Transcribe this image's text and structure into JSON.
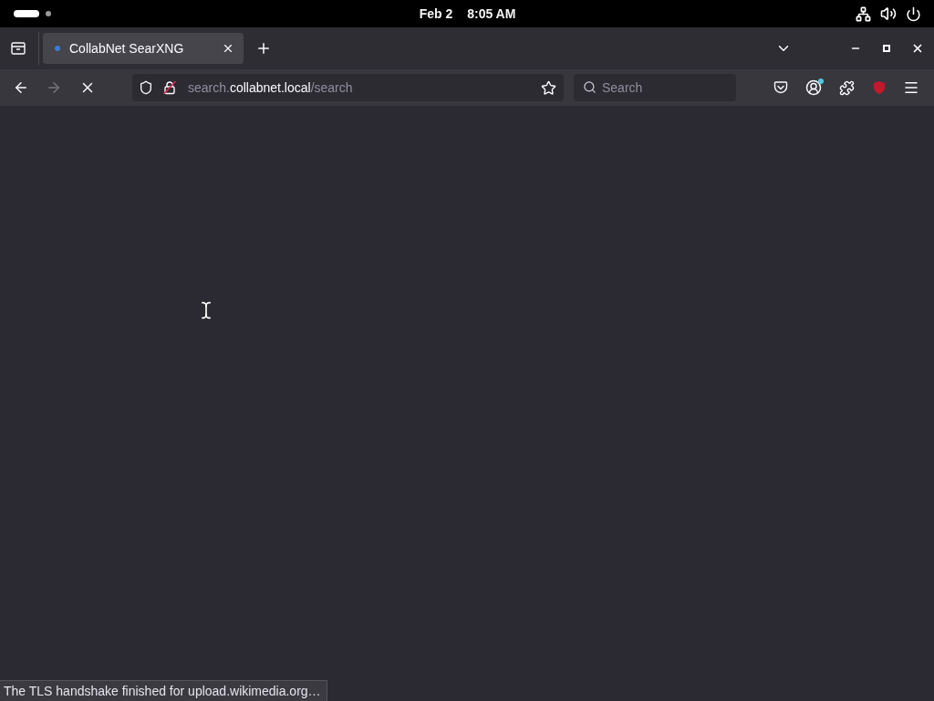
{
  "top_bar": {
    "workspaces": [
      {
        "selected": true
      },
      {
        "selected": false
      }
    ],
    "date": "Feb 2",
    "time": "8:05 AM"
  },
  "tabs": [
    {
      "title": "CollabNet SearXNG",
      "selected": true
    }
  ],
  "navigation": {
    "back_disabled": false,
    "forward_disabled": true,
    "loading": true
  },
  "url_bar": {
    "secure": false,
    "segments": [
      {
        "text": "search.",
        "kind": "dim"
      },
      {
        "text": "collabnet.local",
        "kind": "host"
      },
      {
        "text": "/search",
        "kind": "dim"
      }
    ]
  },
  "search_field": {
    "placeholder": "Search"
  },
  "account": {
    "badge": true
  },
  "status_bar": {
    "text": "The TLS handshake finished for upload.wikimedia.org…"
  }
}
